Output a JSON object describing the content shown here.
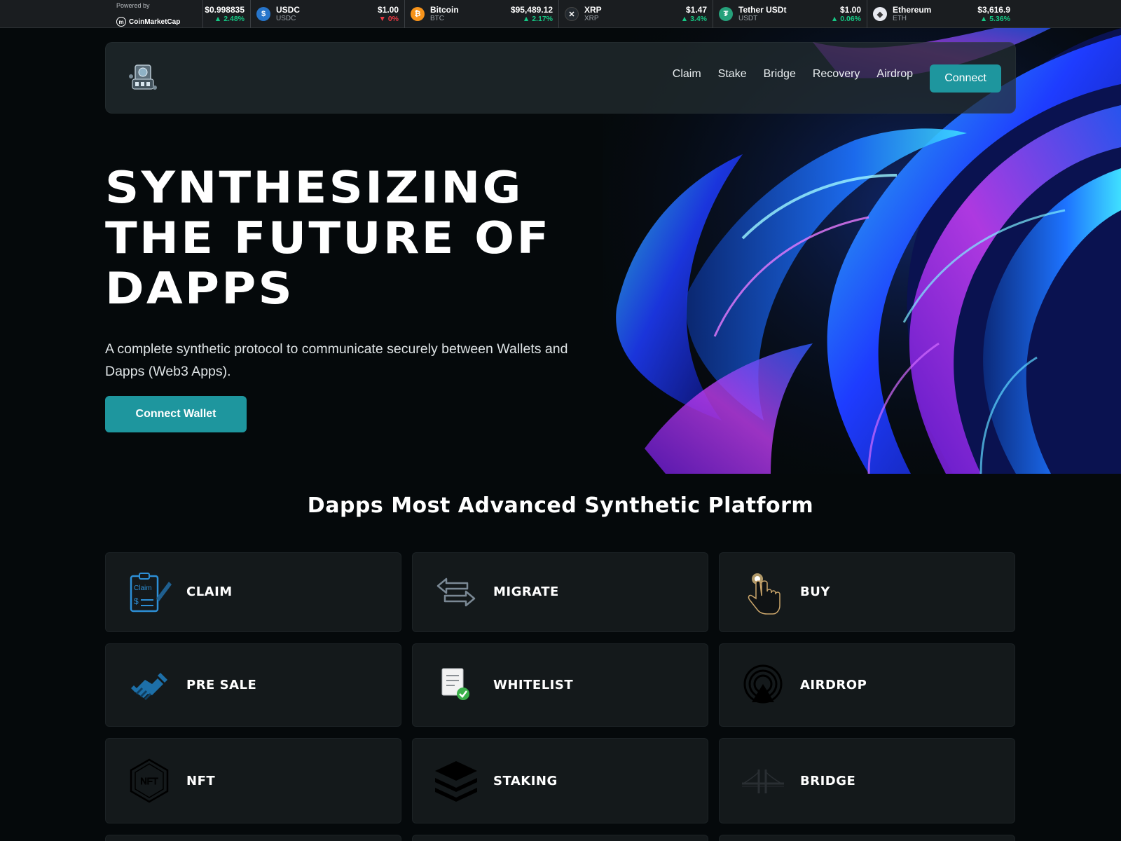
{
  "ticker": {
    "powered_by": "Powered by",
    "brand": "CoinMarketCap",
    "items": [
      {
        "name": "",
        "symbol": "",
        "price": "$0.998835",
        "change": "2.48%",
        "direction": "up",
        "color": "#1a1d20"
      },
      {
        "name": "USDC",
        "symbol": "USDC",
        "price": "$1.00",
        "change": "0%",
        "direction": "down",
        "color": "#2775ca",
        "icon": "usdc-icon"
      },
      {
        "name": "Bitcoin",
        "symbol": "BTC",
        "price": "$95,489.12",
        "change": "2.17%",
        "direction": "up",
        "color": "#f7931a",
        "icon": "bitcoin-icon"
      },
      {
        "name": "XRP",
        "symbol": "XRP",
        "price": "$1.47",
        "change": "3.4%",
        "direction": "up",
        "color": "#23292f",
        "icon": "xrp-icon"
      },
      {
        "name": "Tether USDt",
        "symbol": "USDT",
        "price": "$1.00",
        "change": "0.06%",
        "direction": "up",
        "color": "#26a17b",
        "icon": "tether-icon"
      },
      {
        "name": "Ethereum",
        "symbol": "ETH",
        "price": "$3,616.9",
        "change": "5.36%",
        "direction": "up",
        "color": "#627eea",
        "icon": "ethereum-icon"
      }
    ]
  },
  "nav": {
    "links": [
      "Claim",
      "Stake",
      "Bridge",
      "Recovery",
      "Airdrop"
    ],
    "connect_label": "Connect"
  },
  "hero": {
    "title_lines": [
      "SYNTHESIZING",
      "THE FUTURE OF",
      "DAPPS"
    ],
    "subtitle": "A complete synthetic protocol to communicate securely between Wallets and Dapps (Web3 Apps).",
    "cta_label": "Connect Wallet"
  },
  "section": {
    "title": "Dapps Most Advanced Synthetic Platform",
    "cards": [
      {
        "label": "CLAIM",
        "icon": "claim-icon"
      },
      {
        "label": "MIGRATE",
        "icon": "migrate-icon"
      },
      {
        "label": "BUY",
        "icon": "buy-icon"
      },
      {
        "label": "PRE SALE",
        "icon": "presale-icon"
      },
      {
        "label": "WHITELIST",
        "icon": "whitelist-icon"
      },
      {
        "label": "AIRDROP",
        "icon": "airdrop-icon"
      },
      {
        "label": "NFT",
        "icon": "nft-icon"
      },
      {
        "label": "STAKING",
        "icon": "staking-icon"
      },
      {
        "label": "BRIDGE",
        "icon": "bridge-icon"
      }
    ]
  },
  "colors": {
    "accent": "#1e969e",
    "background": "#05090b",
    "card": "#14191b",
    "up": "#16c784",
    "down": "#ea3943"
  }
}
